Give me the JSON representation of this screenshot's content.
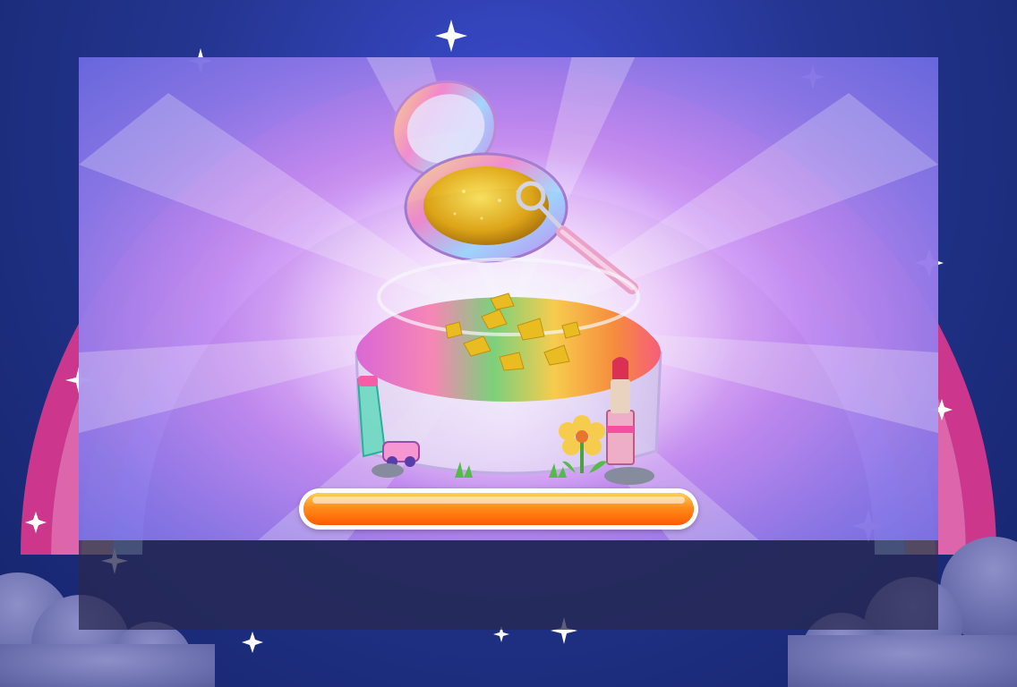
{
  "scene": {
    "name": "rainbow-slime-making",
    "colors": {
      "sky_top": "#23358f",
      "accent_orange": "#ff8d1a",
      "gold": "#f1c31c",
      "pink": "#f05bb6"
    }
  },
  "progress": {
    "fraction": 1.0
  },
  "icons": {
    "compact": "compact-powder-icon",
    "jar": "slime-jar-icon",
    "spoon": "scoop-spoon-icon",
    "lipstick": "lipstick-icon",
    "flower": "flower-icon",
    "star": "sparkle-star-icon"
  }
}
